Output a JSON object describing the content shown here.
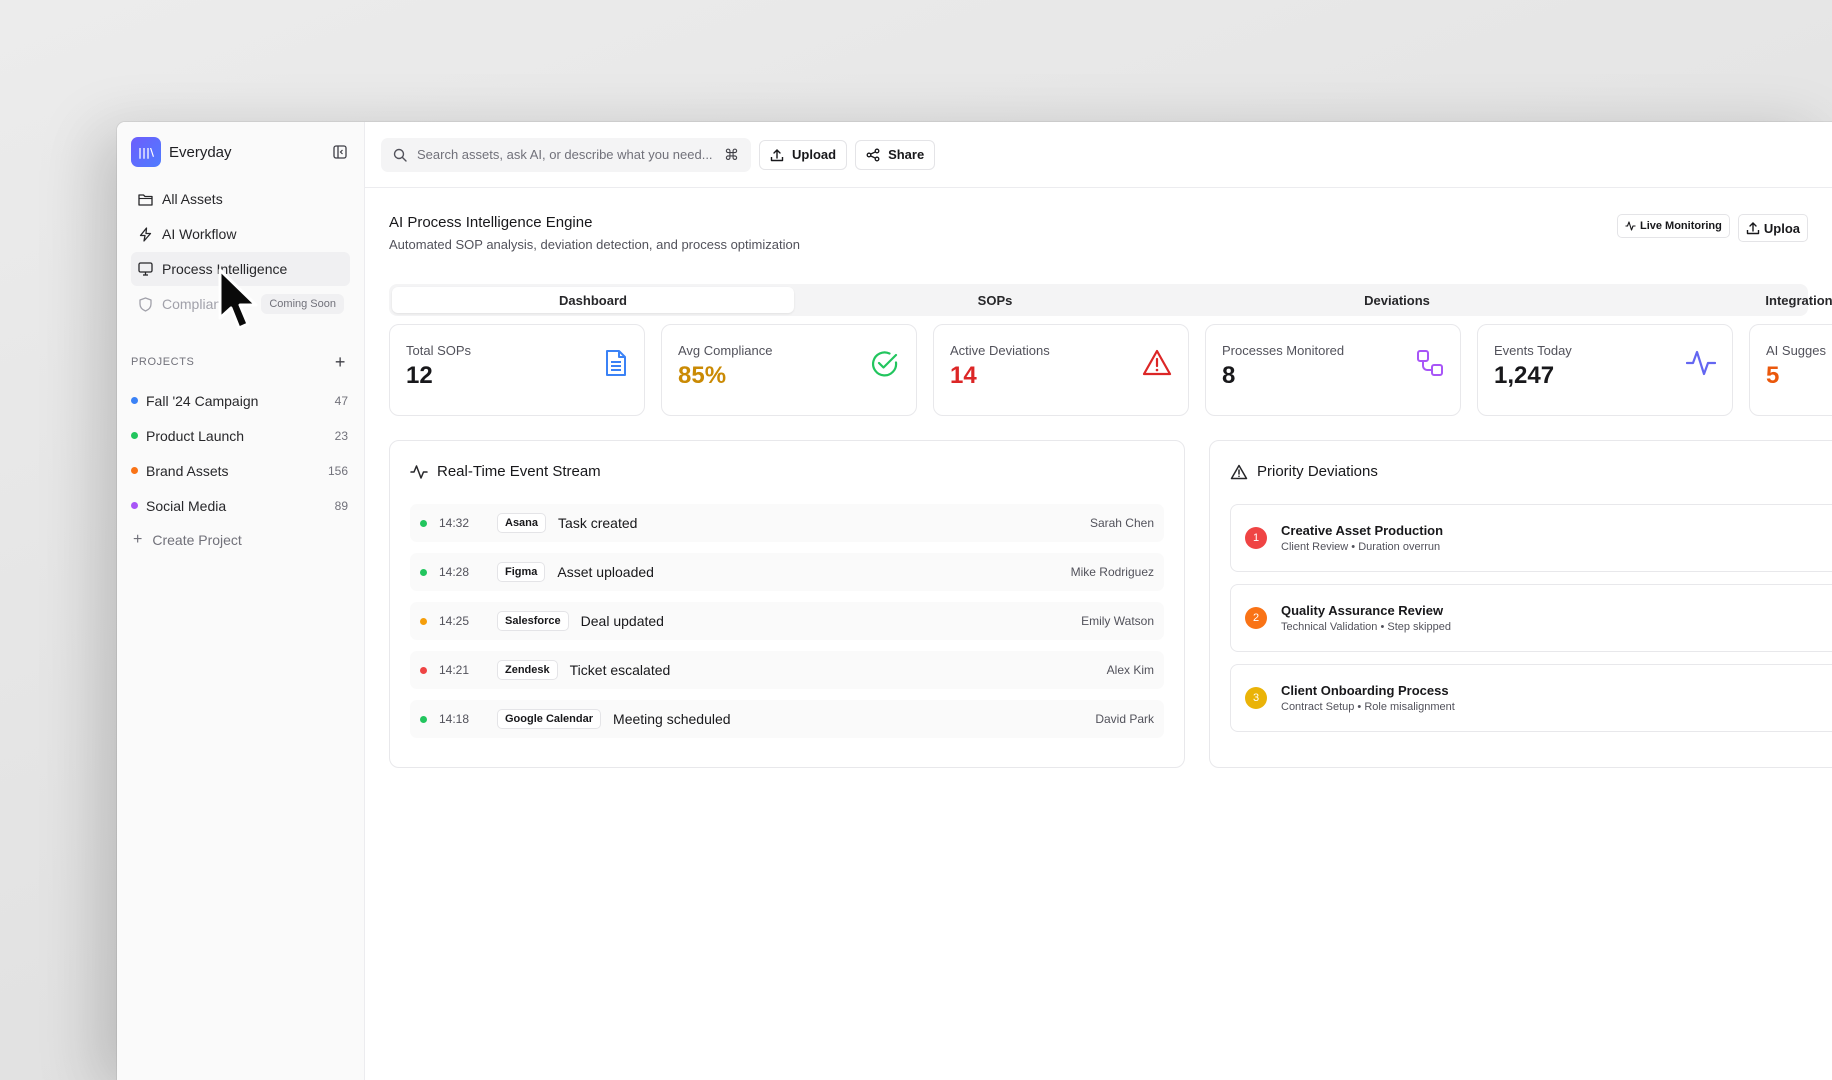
{
  "app": {
    "name": "Everyday",
    "logo_text": "|||\\"
  },
  "sidebar": {
    "nav": [
      {
        "label": "All Assets",
        "icon": "folder-icon"
      },
      {
        "label": "AI Workflow",
        "icon": "lightning-icon"
      },
      {
        "label": "Process Intelligence",
        "icon": "monitor-icon"
      },
      {
        "label": "Compliance",
        "icon": "shield-icon",
        "badge": "Coming Soon"
      }
    ],
    "projects_heading": "PROJECTS",
    "projects": [
      {
        "name": "Fall '24 Campaign",
        "count": "47",
        "color": "#3b82f6"
      },
      {
        "name": "Product Launch",
        "count": "23",
        "color": "#22c55e"
      },
      {
        "name": "Brand Assets",
        "count": "156",
        "color": "#f97316"
      },
      {
        "name": "Social Media",
        "count": "89",
        "color": "#a855f7"
      }
    ],
    "create_project": "Create Project"
  },
  "topbar": {
    "search_placeholder": "Search assets, ask AI, or describe what you need...",
    "shortcut": "⌘",
    "upload_label": "Upload",
    "share_label": "Share"
  },
  "page": {
    "title": "AI Process Intelligence Engine",
    "subtitle": "Automated SOP analysis, deviation detection, and process optimization",
    "live_monitoring_label": "Live Monitoring",
    "upload_label": "Uploa"
  },
  "tabs": [
    "Dashboard",
    "SOPs",
    "Deviations",
    "Integration"
  ],
  "stats": [
    {
      "label": "Total SOPs",
      "value": "12",
      "color": "#18181b",
      "icon": "document-icon",
      "icon_color": "#3b82f6"
    },
    {
      "label": "Avg Compliance",
      "value": "85%",
      "color": "#ca8a04",
      "icon": "check-circle-icon",
      "icon_color": "#22c55e"
    },
    {
      "label": "Active Deviations",
      "value": "14",
      "color": "#dc2626",
      "icon": "warning-triangle-icon",
      "icon_color": "#dc2626"
    },
    {
      "label": "Processes Monitored",
      "value": "8",
      "color": "#18181b",
      "icon": "workflow-icon",
      "icon_color": "#a855f7"
    },
    {
      "label": "Events Today",
      "value": "1,247",
      "color": "#18181b",
      "icon": "activity-icon",
      "icon_color": "#6366f1"
    },
    {
      "label": "AI Sugges",
      "value": "5",
      "color": "#ea580c",
      "icon": "",
      "icon_color": ""
    }
  ],
  "event_stream": {
    "title": "Real-Time Event Stream",
    "events": [
      {
        "time": "14:32",
        "app": "Asana",
        "text": "Task created",
        "user": "Sarah Chen",
        "dot": "#22c55e"
      },
      {
        "time": "14:28",
        "app": "Figma",
        "text": "Asset uploaded",
        "user": "Mike Rodriguez",
        "dot": "#22c55e"
      },
      {
        "time": "14:25",
        "app": "Salesforce",
        "text": "Deal updated",
        "user": "Emily Watson",
        "dot": "#f59e0b"
      },
      {
        "time": "14:21",
        "app": "Zendesk",
        "text": "Ticket escalated",
        "user": "Alex Kim",
        "dot": "#ef4444"
      },
      {
        "time": "14:18",
        "app": "Google Calendar",
        "text": "Meeting scheduled",
        "user": "David Park",
        "dot": "#22c55e"
      }
    ]
  },
  "priority_deviations": {
    "title": "Priority Deviations",
    "items": [
      {
        "num": "1",
        "title": "Creative Asset Production",
        "sub": "Client Review • Duration overrun",
        "color": "#ef4444"
      },
      {
        "num": "2",
        "title": "Quality Assurance Review",
        "sub": "Technical Validation • Step skipped",
        "color": "#f97316"
      },
      {
        "num": "3",
        "title": "Client Onboarding Process",
        "sub": "Contract Setup • Role misalignment",
        "color": "#eab308"
      }
    ]
  }
}
